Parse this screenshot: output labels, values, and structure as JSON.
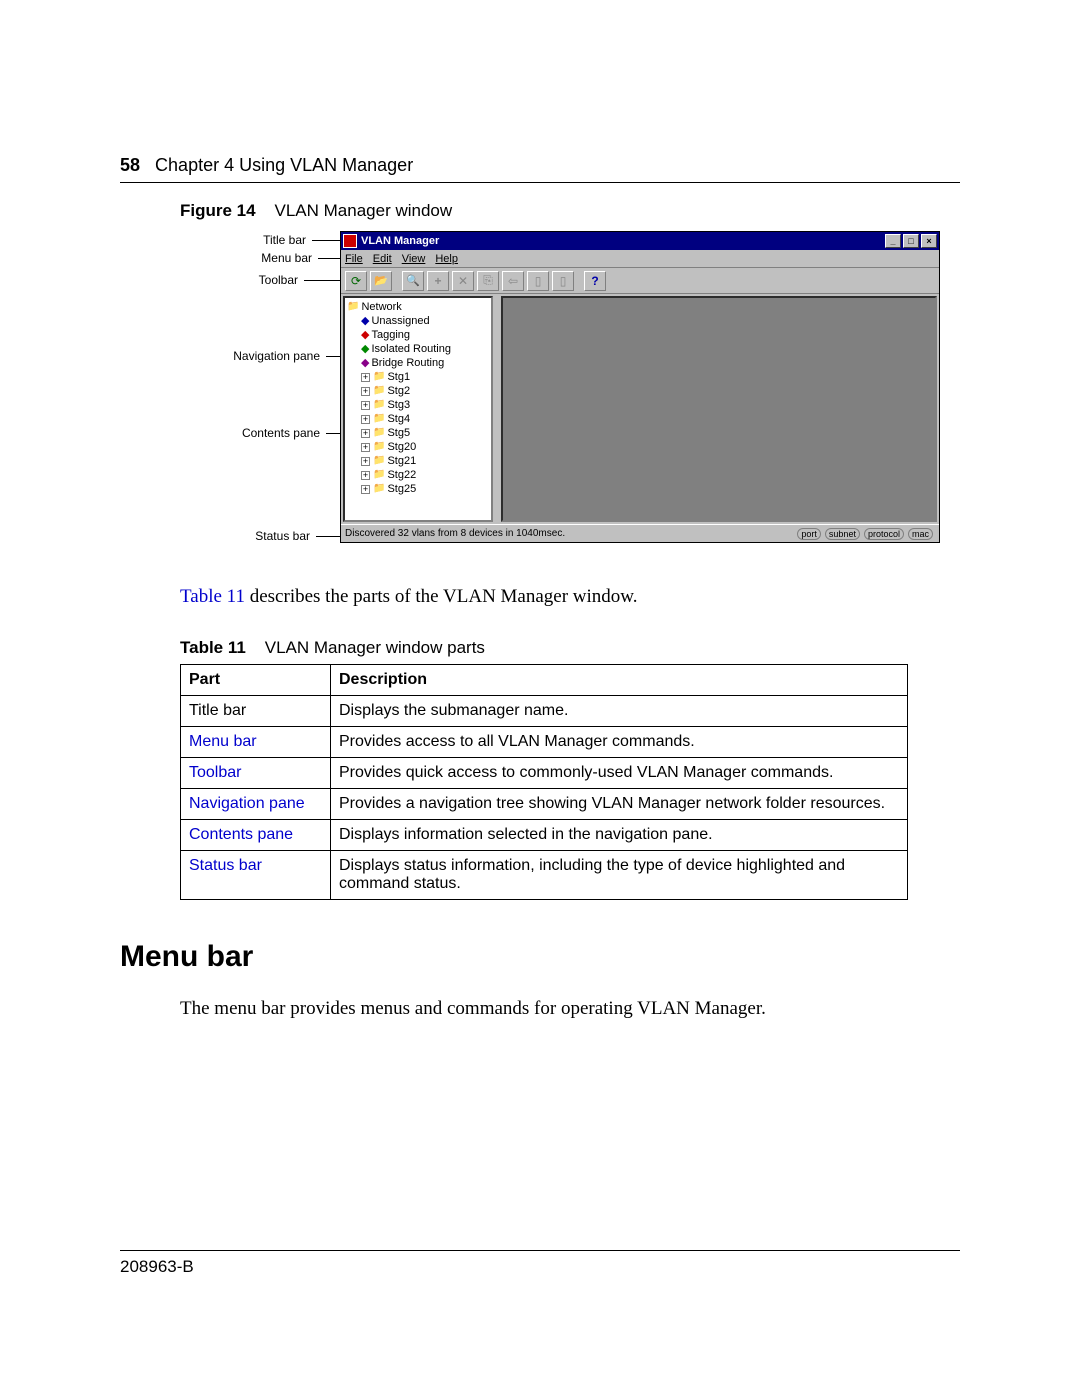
{
  "header": {
    "page_number": "58",
    "chapter": "Chapter 4  Using VLAN Manager"
  },
  "figure": {
    "label": "Figure 14",
    "title": "VLAN Manager window"
  },
  "callouts": {
    "title_bar": "Title bar",
    "menu_bar": "Menu bar",
    "toolbar": "Toolbar",
    "navigation_pane": "Navigation pane",
    "contents_pane": "Contents pane",
    "status_bar": "Status bar"
  },
  "window": {
    "title": "VLAN Manager",
    "menus": {
      "file": "File",
      "edit": "Edit",
      "view": "View",
      "help": "Help"
    },
    "tree": {
      "root": "Network",
      "items": [
        "Unassigned",
        "Tagging",
        "Isolated Routing",
        "Bridge Routing"
      ],
      "stgs": [
        "Stg1",
        "Stg2",
        "Stg3",
        "Stg4",
        "Stg5",
        "Stg20",
        "Stg21",
        "Stg22",
        "Stg25"
      ]
    },
    "status_left": "Discovered 32 vlans from 8 devices in 1040msec.",
    "status_tags": [
      "port",
      "subnet",
      "protocol",
      "mac"
    ]
  },
  "para1": {
    "pre": "Table 11",
    "post": " describes the parts of the VLAN Manager window."
  },
  "table": {
    "label": "Table 11",
    "title": "VLAN Manager window parts",
    "h1": "Part",
    "h2": "Description",
    "rows": [
      {
        "part": "Title bar",
        "link": false,
        "desc": "Displays the submanager name."
      },
      {
        "part": "Menu bar",
        "link": true,
        "desc": "Provides access to all VLAN Manager commands."
      },
      {
        "part": "Toolbar",
        "link": true,
        "desc": "Provides quick access to commonly-used VLAN Manager commands."
      },
      {
        "part": "Navigation pane",
        "link": true,
        "desc": "Provides a navigation tree showing VLAN Manager network folder resources."
      },
      {
        "part": "Contents pane",
        "link": true,
        "desc": "Displays information selected in the navigation pane."
      },
      {
        "part": "Status bar",
        "link": true,
        "desc": "Displays status information, including the type of device highlighted and command status."
      }
    ]
  },
  "section_heading": "Menu bar",
  "para2": "The menu bar provides menus and commands for operating VLAN Manager.",
  "footer": "208963-B"
}
